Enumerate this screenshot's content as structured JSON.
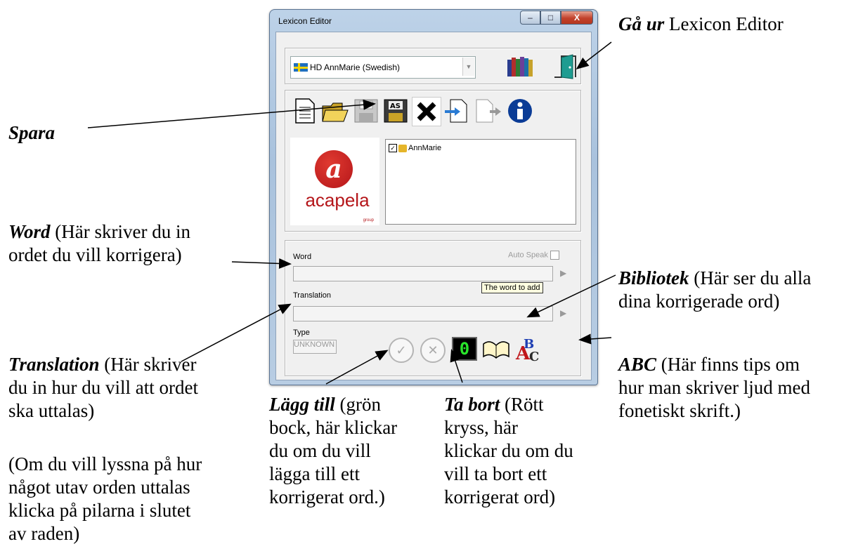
{
  "window": {
    "title": "Lexicon Editor",
    "minimize": "–",
    "maximize": "□",
    "close": "X",
    "voice_select": "HD AnnMarie (Swedish)",
    "tree_item": "AnnMarie",
    "logo_text": "acapela",
    "logo_group": "group",
    "word_label": "Word",
    "auto_speak_label": "Auto Speak",
    "translation_label": "Translation",
    "type_label": "Type",
    "type_value": "UNKNOWN",
    "tooltip": "The word to add",
    "counter": "0"
  },
  "toolbar_icons": [
    "new-document-icon",
    "open-folder-icon",
    "save-icon",
    "save-as-icon",
    "delete-icon",
    "import-icon",
    "export-icon",
    "info-icon"
  ],
  "annotations": {
    "exit": {
      "bold": "Gå ur",
      "rest": " Lexicon Editor"
    },
    "save": {
      "bold": "Spara",
      "rest": ""
    },
    "word": {
      "bold": "Word",
      "rest": " (Här skriver du in\nordet du vill korrigera)"
    },
    "translation": {
      "bold": "Translation",
      "rest": " (Här skriver\ndu in hur du vill att ordet\nska uttalas)"
    },
    "listen": "(Om du vill lyssna på hur\nnågot utav orden uttalas\nklicka på pilarna i slutet\nav raden)",
    "add": {
      "bold": "Lägg till",
      "rest": " (grön\nbock, här klickar\ndu om du vill\nlägga till ett\nkorrigerat ord.)"
    },
    "remove": {
      "bold": "Ta bort",
      "rest": " (Rött\nkryss, här\nklickar du om du\nvill ta bort ett\nkorrigerat ord)"
    },
    "library": {
      "bold": "Bibliotek",
      "rest": " (Här ser du alla\ndina korrigerade ord)"
    },
    "abc": {
      "bold": "ABC",
      "rest": " (Här finns tips om\nhur man skriver ljud med\nfonetiskt skrift.)"
    }
  }
}
